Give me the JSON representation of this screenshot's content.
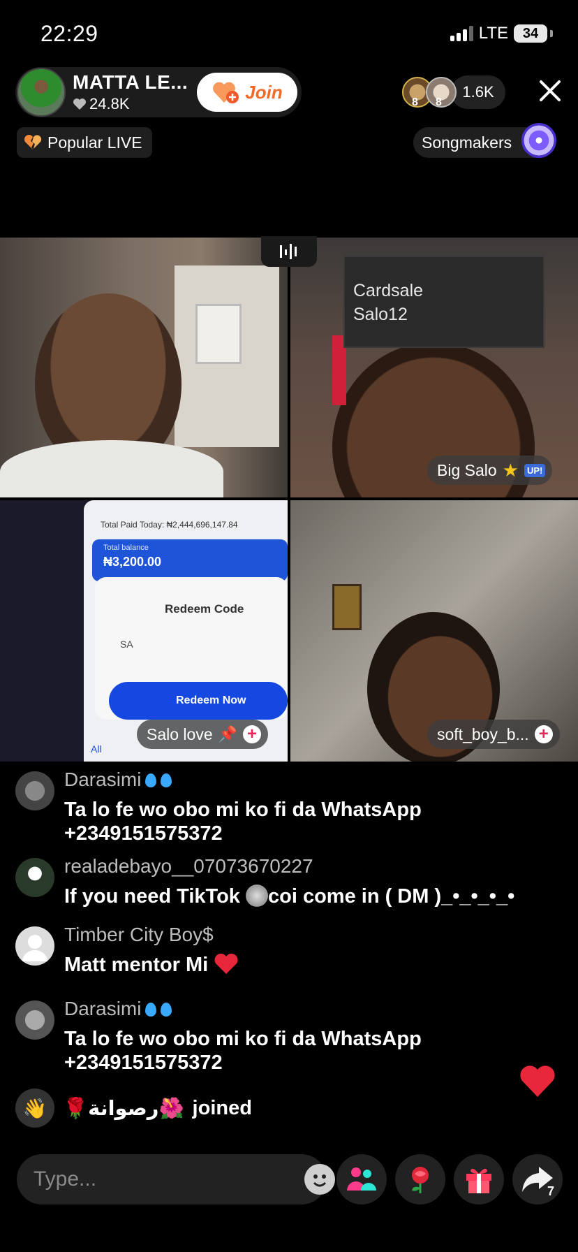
{
  "status": {
    "time": "22:29",
    "network": "LTE",
    "battery": "34"
  },
  "host": {
    "name": "MATTA LE...",
    "likes": "24.8K",
    "join_label": "Join"
  },
  "viewers": {
    "badge1": "8",
    "badge2": "8",
    "count": "1.6K"
  },
  "pills": {
    "popular": "Popular LIVE",
    "songmakers": "Songmakers"
  },
  "tiles": {
    "overlay_line1": "Cardsale",
    "overlay_line2": "Salo12",
    "guest2": "Big Salo",
    "guest2_badge": "UP!",
    "guest3": "Salo love",
    "guest4": "soft_boy_b...",
    "phone": {
      "total_paid": "Total Paid Today: ₦2,444,696,147.84",
      "balance_label": "Total balance",
      "balance": "₦3,200.00",
      "redeem_title": "Redeem Code",
      "code": "SA",
      "redeem_btn": "Redeem Now",
      "tab": "All"
    }
  },
  "chat": [
    {
      "user": "Darasimi",
      "text1": "Ta lo fe wo obo mi ko fi da WhatsApp",
      "text2": "+2349151575372"
    },
    {
      "user": "realadebayo__07073670227",
      "text1": "If you need TikTok",
      "text1b": "coi come in ( DM )_•_•_•_•"
    },
    {
      "user": "Timber City Boy$",
      "text1": "Matt mentor Mi"
    },
    {
      "user": "Darasimi",
      "text1": "Ta lo fe wo obo mi ko fi da WhatsApp",
      "text2": "+2349151575372"
    }
  ],
  "joined": {
    "name": "🌹رصوانة🌺",
    "suffix": "joined"
  },
  "input": {
    "placeholder": "Type..."
  },
  "share_count": "7",
  "icons": [
    "heart-icon",
    "close-icon",
    "broken-heart-icon",
    "disc-icon",
    "audio-bars-icon",
    "pin-icon",
    "plus-icon",
    "wave-icon",
    "emoji-icon",
    "guests-icon",
    "rose-icon",
    "gift-icon",
    "share-icon"
  ]
}
